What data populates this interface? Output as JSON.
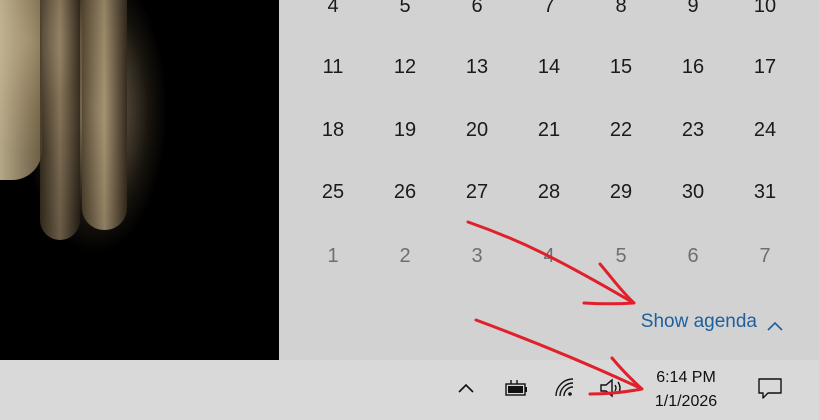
{
  "calendar": {
    "weeks": [
      {
        "days": [
          {
            "label": "4",
            "dim": false
          },
          {
            "label": "5",
            "dim": false
          },
          {
            "label": "6",
            "dim": false
          },
          {
            "label": "7",
            "dim": false
          },
          {
            "label": "8",
            "dim": false
          },
          {
            "label": "9",
            "dim": false
          },
          {
            "label": "10",
            "dim": false
          }
        ]
      },
      {
        "days": [
          {
            "label": "11",
            "dim": false
          },
          {
            "label": "12",
            "dim": false
          },
          {
            "label": "13",
            "dim": false
          },
          {
            "label": "14",
            "dim": false
          },
          {
            "label": "15",
            "dim": false
          },
          {
            "label": "16",
            "dim": false
          },
          {
            "label": "17",
            "dim": false
          }
        ]
      },
      {
        "days": [
          {
            "label": "18",
            "dim": false
          },
          {
            "label": "19",
            "dim": false
          },
          {
            "label": "20",
            "dim": false
          },
          {
            "label": "21",
            "dim": false
          },
          {
            "label": "22",
            "dim": false
          },
          {
            "label": "23",
            "dim": false
          },
          {
            "label": "24",
            "dim": false
          }
        ]
      },
      {
        "days": [
          {
            "label": "25",
            "dim": false
          },
          {
            "label": "26",
            "dim": false
          },
          {
            "label": "27",
            "dim": false
          },
          {
            "label": "28",
            "dim": false
          },
          {
            "label": "29",
            "dim": false
          },
          {
            "label": "30",
            "dim": false
          },
          {
            "label": "31",
            "dim": false
          }
        ]
      },
      {
        "days": [
          {
            "label": "1",
            "dim": true
          },
          {
            "label": "2",
            "dim": true
          },
          {
            "label": "3",
            "dim": true
          },
          {
            "label": "4",
            "dim": true
          },
          {
            "label": "5",
            "dim": true
          },
          {
            "label": "6",
            "dim": true
          },
          {
            "label": "7",
            "dim": true
          }
        ]
      }
    ],
    "show_agenda_label": "Show agenda",
    "agenda_icon": "chevron-up-icon"
  },
  "taskbar": {
    "clock_time": "6:14 PM",
    "clock_date": "1/1/2026",
    "tray_icons": [
      "chevron-up-icon",
      "battery-icon",
      "wifi-icon",
      "volume-icon",
      "notification-icon"
    ]
  },
  "colors": {
    "flyout_bg": "#d2d2d2",
    "taskbar_bg": "#d9d9d9",
    "accent_link": "#1e5f9e",
    "annotation_red": "#e0202a"
  }
}
